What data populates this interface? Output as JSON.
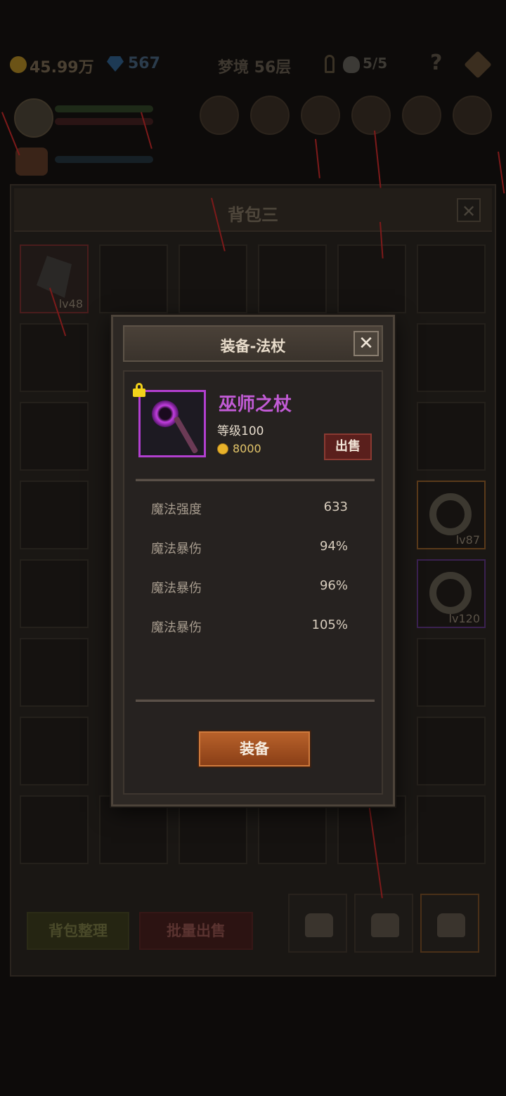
{
  "hud": {
    "gold": "45.99万",
    "gems": "567",
    "floor": "梦境 56层",
    "skull_count": "5/5",
    "help": "?"
  },
  "backpack": {
    "title": "背包三",
    "close": "✕",
    "slots": [
      {
        "level": "lv48"
      },
      {
        "level": "lv87"
      },
      {
        "level": "lv120"
      }
    ],
    "organize_label": "背包整理",
    "bulk_sell_label": "批量出售"
  },
  "dialog": {
    "title": "装备-法杖",
    "close": "✕",
    "item": {
      "name": "巫师之杖",
      "level": "等级100",
      "price": "8000",
      "locked": true
    },
    "sell_label": "出售",
    "stats": [
      {
        "label": "魔法强度",
        "value": "633"
      },
      {
        "label": "魔法暴伤",
        "value": "94%"
      },
      {
        "label": "魔法暴伤",
        "value": "96%"
      },
      {
        "label": "魔法暴伤",
        "value": "105%"
      }
    ],
    "equip_label": "装备"
  },
  "colors": {
    "rarity_purple": "#b23fd0",
    "item_name": "#c25bd6",
    "equip_button": "#a4521f",
    "sell_button": "#5a1f1c",
    "lock": "#f2d21a"
  }
}
